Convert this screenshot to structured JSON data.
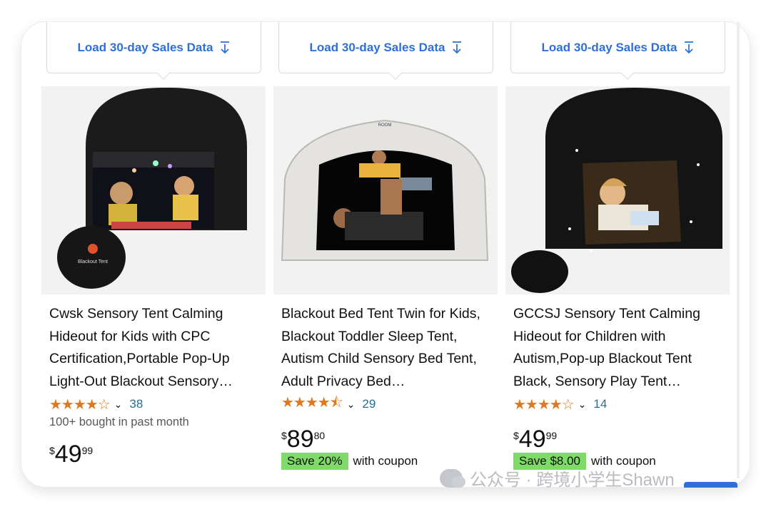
{
  "products": [
    {
      "sales_button": "Load 30-day Sales Data",
      "title": "Cwsk Sensory Tent Calming Hideout for Kids with CPC Certification,Portable Pop-Up Light-Out Blackout Sensory…",
      "rating": 4.0,
      "stars": "★★★★☆",
      "review_count": "38",
      "bought": "100+ bought in past month",
      "price_symbol": "$",
      "price_whole": "49",
      "price_fraction": "99",
      "coupon_badge": "",
      "coupon_text": ""
    },
    {
      "sales_button": "Load 30-day Sales Data",
      "title": "Blackout Bed Tent Twin for Kids, Blackout Toddler Sleep Tent, Autism Child Sensory Bed Tent, Adult Privacy Bed…",
      "rating": 4.5,
      "stars": "★★★★⯪",
      "review_count": "29",
      "bought": "",
      "price_symbol": "$",
      "price_whole": "89",
      "price_fraction": "80",
      "coupon_badge": "Save 20%",
      "coupon_text": "with coupon"
    },
    {
      "sales_button": "Load 30-day Sales Data",
      "title": "GCCSJ Sensory Tent Calming Hideout for Children with Autism,Pop-up Blackout Tent Black, Sensory Play Tent…",
      "rating": 4.0,
      "stars": "★★★★☆",
      "review_count": "14",
      "bought": "",
      "price_symbol": "$",
      "price_whole": "49",
      "price_fraction": "99",
      "coupon_badge": "Save $8.00",
      "coupon_text": "with coupon"
    }
  ],
  "watermark": "公众号 · 跨境小学生Shawn",
  "colors": {
    "link_blue": "#2f6fd6",
    "star_orange": "#de7921",
    "coupon_green": "#7fda69",
    "review_count": "#2a6d8f"
  },
  "icons": [
    "download-icon",
    "chevron-down-icon",
    "wechat-icon"
  ]
}
